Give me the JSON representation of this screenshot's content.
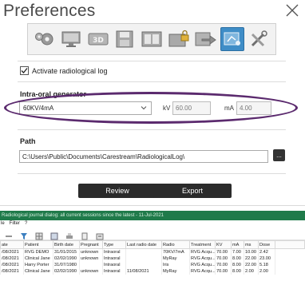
{
  "dialog": {
    "title": "Preferences",
    "toolbar_icons": [
      "gears-icon",
      "monitor-icon",
      "3d-icon",
      "save-icon",
      "image-layout-icon",
      "lock-folder-icon",
      "export-icon",
      "radiation-log-icon",
      "tools-icon"
    ],
    "activate_label": "Activate radiological log",
    "activate_checked": true,
    "generator_label": "Intra-oral generator",
    "generator_value": "60KV/4mA",
    "kv_label": "kV",
    "kv_value": "60.00",
    "ma_label": "mA",
    "ma_value": "4.00",
    "path_label": "Path",
    "path_value": "C:\\Users\\Public\\Documents\\Carestream\\RadiologicalLog\\",
    "browse_label": "...",
    "review_label": "Review",
    "export_label": "Export",
    "accent_color": "#3f8dc7",
    "highlight_color": "#5b2a6e"
  },
  "log": {
    "title": "Radiological journal dialog: all current sessions since the latest - 11-Jul-2021",
    "menu": [
      "le",
      "Filter",
      "?"
    ],
    "columns": [
      "ate",
      "Patient",
      "Birth date",
      "Pregnant",
      "Type",
      "Last radio date",
      "Radio",
      "Treatment",
      "KV",
      "mA",
      "ms",
      "Dose"
    ],
    "rows": [
      [
        "/08/2021",
        "RVG DEMO",
        "31/01/2015",
        "unknown",
        "Intraoral",
        "",
        "70KV/7mA",
        "RVG Acqu...",
        "70.00",
        "7.00",
        "10.00",
        "2.42"
      ],
      [
        "/08/2021",
        "Clinical Jane",
        "02/02/1990",
        "unknown",
        "Intraoral",
        "",
        "MyRay",
        "RVG Acqu...",
        "70.00",
        "8.00",
        "22.00",
        "23.00"
      ],
      [
        "/08/2021",
        "Harry Porter",
        "31/07/1980",
        "",
        "Intraoral",
        "",
        "Iris",
        "RVG Acqu...",
        "70.00",
        "8.00",
        "22.00",
        "5.18"
      ],
      [
        "/08/2021",
        "Clinical Jane",
        "02/02/1990",
        "unknown",
        "Intraoral",
        "11/08/2021",
        "MyRay",
        "RVG Acqu...",
        "70.00",
        "8.00",
        "2.00",
        "2.00"
      ]
    ]
  }
}
